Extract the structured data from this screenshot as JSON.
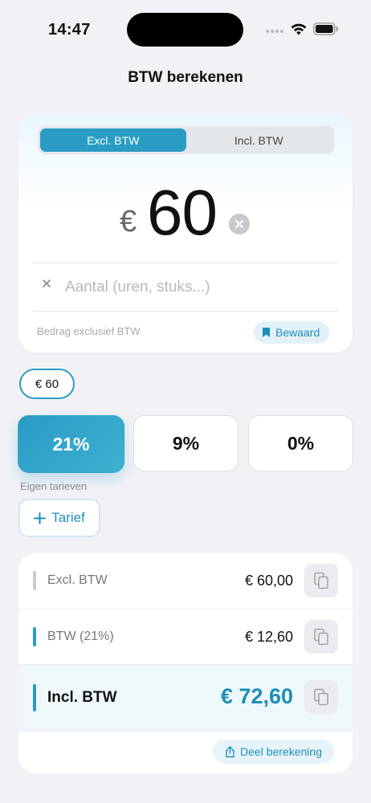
{
  "status": {
    "time": "14:47"
  },
  "page": {
    "title": "BTW berekenen"
  },
  "input": {
    "segments": [
      "Excl. BTW",
      "Incl. BTW"
    ],
    "selected_segment": 0,
    "currency_symbol": "€",
    "amount": "60",
    "quantity_placeholder": "Aantal (uren, stuks...)",
    "quantity_value": "",
    "caption": "Bedrag exclusief BTW",
    "save_label": "Bewaard"
  },
  "history_chip": "€ 60",
  "rates": {
    "options": [
      "21%",
      "9%",
      "0%"
    ],
    "selected": 0,
    "custom_label": "Eigen tarieven",
    "add_label": "Tarief"
  },
  "results": {
    "rows": [
      {
        "label": "Excl. BTW",
        "value": "€ 60,00"
      },
      {
        "label": "BTW (21%)",
        "value": "€ 12,60"
      },
      {
        "label": "Incl. BTW",
        "value": "€ 72,60"
      }
    ],
    "share_label": "Deel berekening"
  },
  "colors": {
    "accent": "#2a9cc4",
    "accent_dark": "#1f8fb8",
    "background": "#f2f2f6"
  }
}
